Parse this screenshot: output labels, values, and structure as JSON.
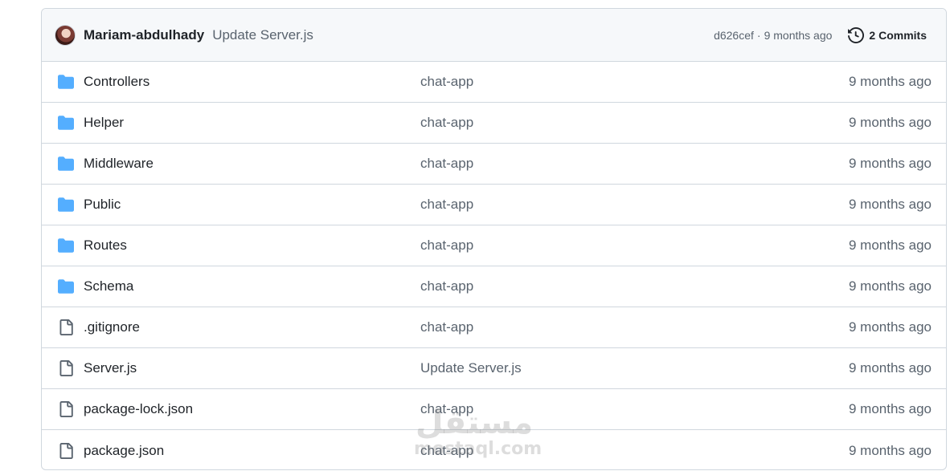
{
  "header": {
    "author": "Mariam-abdulhady",
    "commit_message": "Update Server.js",
    "sha": "d626cef",
    "separator": "·",
    "time": "9 months ago",
    "commits_label": "2 Commits",
    "icons": {
      "avatar": "user-avatar",
      "history": "history-clock-icon"
    }
  },
  "files": [
    {
      "type": "folder",
      "name": "Controllers",
      "message": "chat-app",
      "time": "9 months ago"
    },
    {
      "type": "folder",
      "name": "Helper",
      "message": "chat-app",
      "time": "9 months ago"
    },
    {
      "type": "folder",
      "name": "Middleware",
      "message": "chat-app",
      "time": "9 months ago"
    },
    {
      "type": "folder",
      "name": "Public",
      "message": "chat-app",
      "time": "9 months ago"
    },
    {
      "type": "folder",
      "name": "Routes",
      "message": "chat-app",
      "time": "9 months ago"
    },
    {
      "type": "folder",
      "name": "Schema",
      "message": "chat-app",
      "time": "9 months ago"
    },
    {
      "type": "file",
      "name": ".gitignore",
      "message": "chat-app",
      "time": "9 months ago"
    },
    {
      "type": "file",
      "name": "Server.js",
      "message": "Update Server.js",
      "time": "9 months ago"
    },
    {
      "type": "file",
      "name": "package-lock.json",
      "message": "chat-app",
      "time": "9 months ago"
    },
    {
      "type": "file",
      "name": "package.json",
      "message": "chat-app",
      "time": "9 months ago"
    }
  ],
  "watermark": {
    "arabic": "مستقل",
    "latin": "mostaql.com"
  },
  "colors": {
    "folder": "#54aeff",
    "file_icon": "#59636e",
    "border": "#d0d7de",
    "header_bg": "#f6f8fa",
    "muted_text": "#59636e",
    "text": "#1f2328"
  }
}
